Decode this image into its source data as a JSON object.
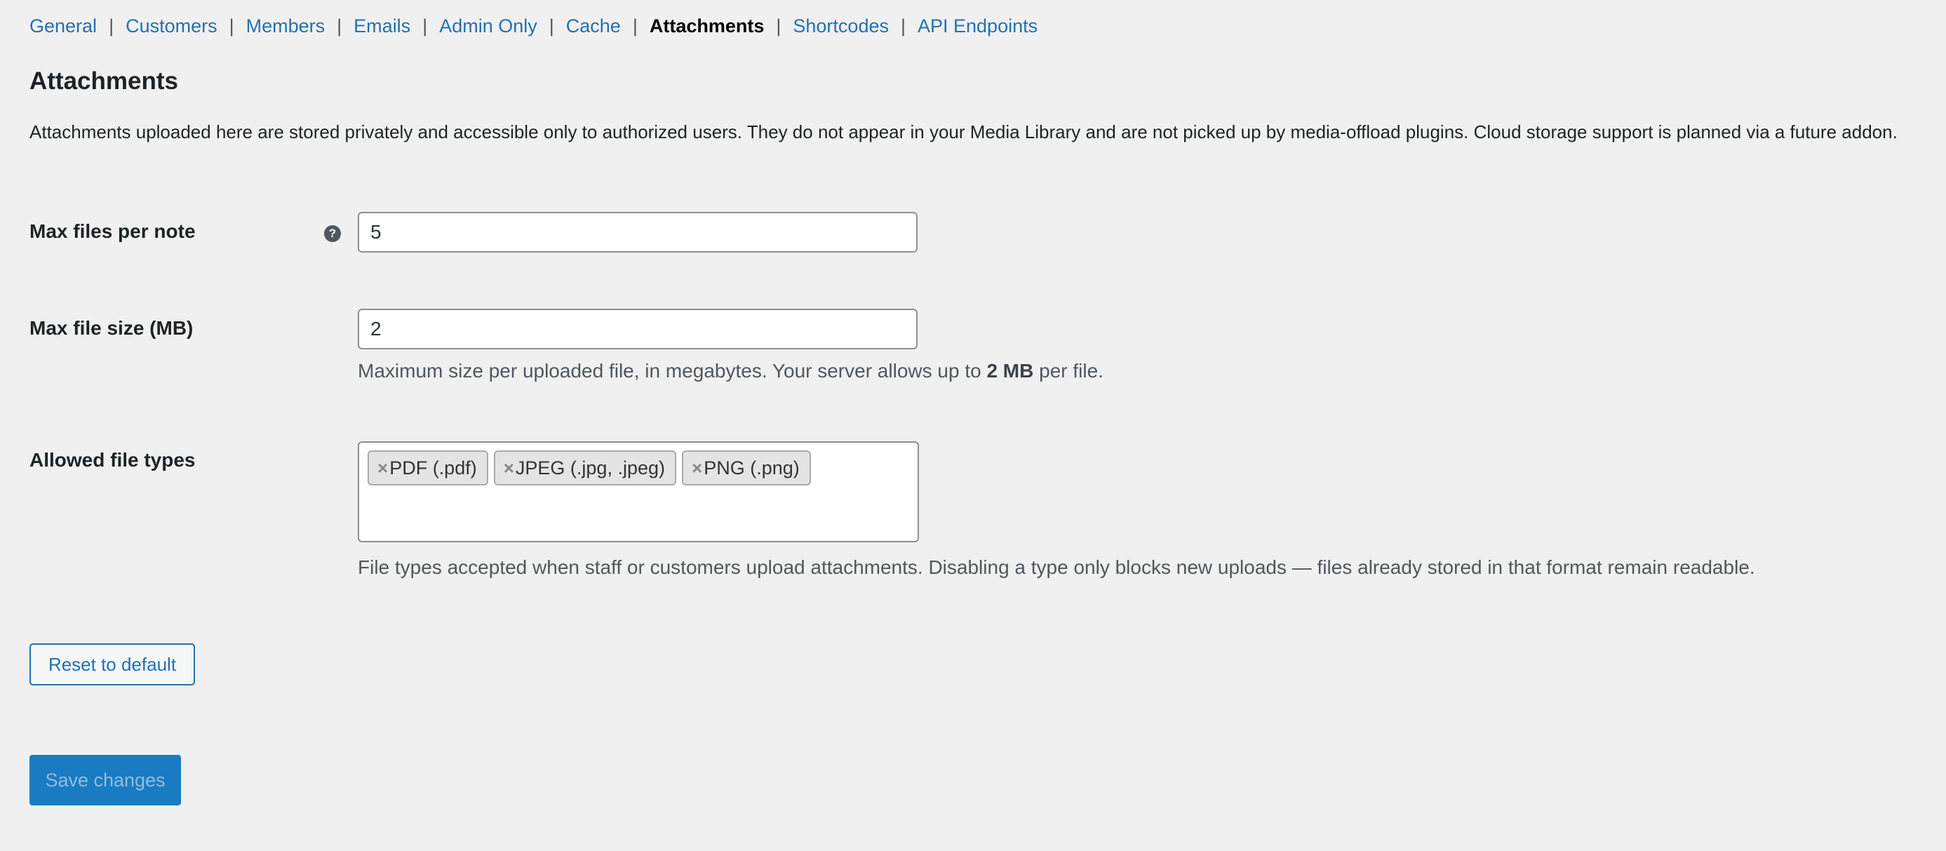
{
  "tabs": [
    {
      "label": "General"
    },
    {
      "label": "Customers"
    },
    {
      "label": "Members"
    },
    {
      "label": "Emails"
    },
    {
      "label": "Admin Only"
    },
    {
      "label": "Cache"
    },
    {
      "label": "Attachments",
      "current": true
    },
    {
      "label": "Shortcodes"
    },
    {
      "label": "API Endpoints"
    }
  ],
  "section": {
    "title": "Attachments",
    "description": "Attachments uploaded here are stored privately and accessible only to authorized users. They do not appear in your Media Library and are not picked up by media-offload plugins. Cloud storage support is planned via a future addon."
  },
  "fields": {
    "max_files": {
      "label": "Max files per note",
      "value": "5",
      "help_icon": "question-icon",
      "help_glyph": "?"
    },
    "max_size": {
      "label": "Max file size (MB)",
      "value": "2",
      "desc_before": "Maximum size per uploaded file, in megabytes. Your server allows up to ",
      "desc_strong": "2 MB",
      "desc_after": " per file."
    },
    "file_types": {
      "label": "Allowed file types",
      "remove_glyph": "×",
      "chips": [
        "PDF (.pdf)",
        "JPEG (.jpg, .jpeg)",
        "PNG (.png)"
      ],
      "description": "File types accepted when staff or customers upload attachments. Disabling a type only blocks new uploads — files already stored in that format remain readable."
    }
  },
  "buttons": {
    "reset": "Reset to default",
    "save": "Save changes"
  },
  "colors": {
    "link": "#2271b1",
    "primary": "#1a7bc2",
    "background": "#f0f0f1"
  }
}
